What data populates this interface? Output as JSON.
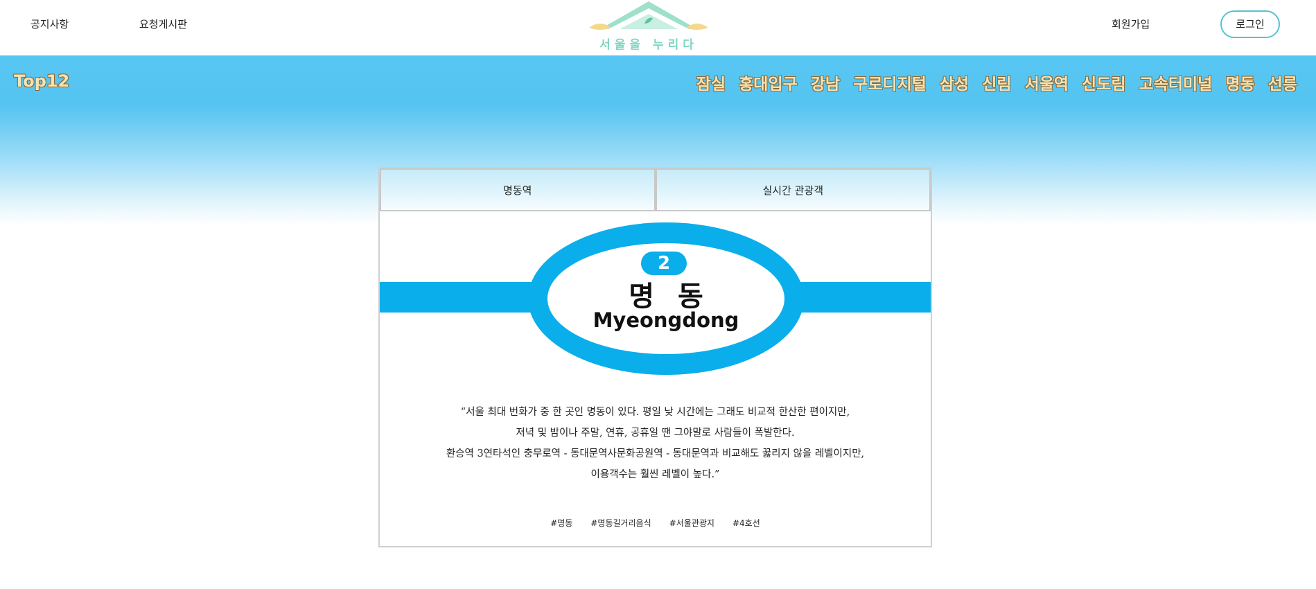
{
  "header": {
    "links": [
      "공지사항",
      "요청게시판"
    ],
    "logo_text": "서울을 누리다",
    "signup_label": "회원가입",
    "login_label": "로그인"
  },
  "nav": {
    "brand": "Top12",
    "items": [
      "잠실",
      "홍대입구",
      "강남",
      "구로디지털",
      "삼성",
      "신림",
      "서울역",
      "신도림",
      "고속터미널",
      "명동",
      "선릉"
    ]
  },
  "card": {
    "tabs": [
      "명동역",
      "실시간 관광객"
    ],
    "station": {
      "line_number": "2",
      "name_kr": "명동",
      "name_en": "Myeongdong"
    },
    "description": [
      "“서울 최대 번화가 중 한 곳인 명동이 있다. 평일 낮 시간에는 그래도 비교적 한산한 편이지만,",
      "저녁 및 밤이나 주말, 연휴, 공휴일 땐 그야말로 사람들이 폭발한다.",
      "환승역 3연타석인 충무로역 - 동대문역사문화공원역 - 동대문역과 비교해도 꿇리지 않을 레벨이지만,",
      "이용객수는 훨씬 레벨이 높다.”"
    ],
    "tags": [
      "#명동",
      "#명동길거리음식",
      "#서울관광지",
      "#4호선"
    ]
  },
  "colors": {
    "banner": "#58c6f2",
    "line2": "#0aaeea",
    "nav_text": "#f3e3b6",
    "login_border": "#56c2cf"
  }
}
